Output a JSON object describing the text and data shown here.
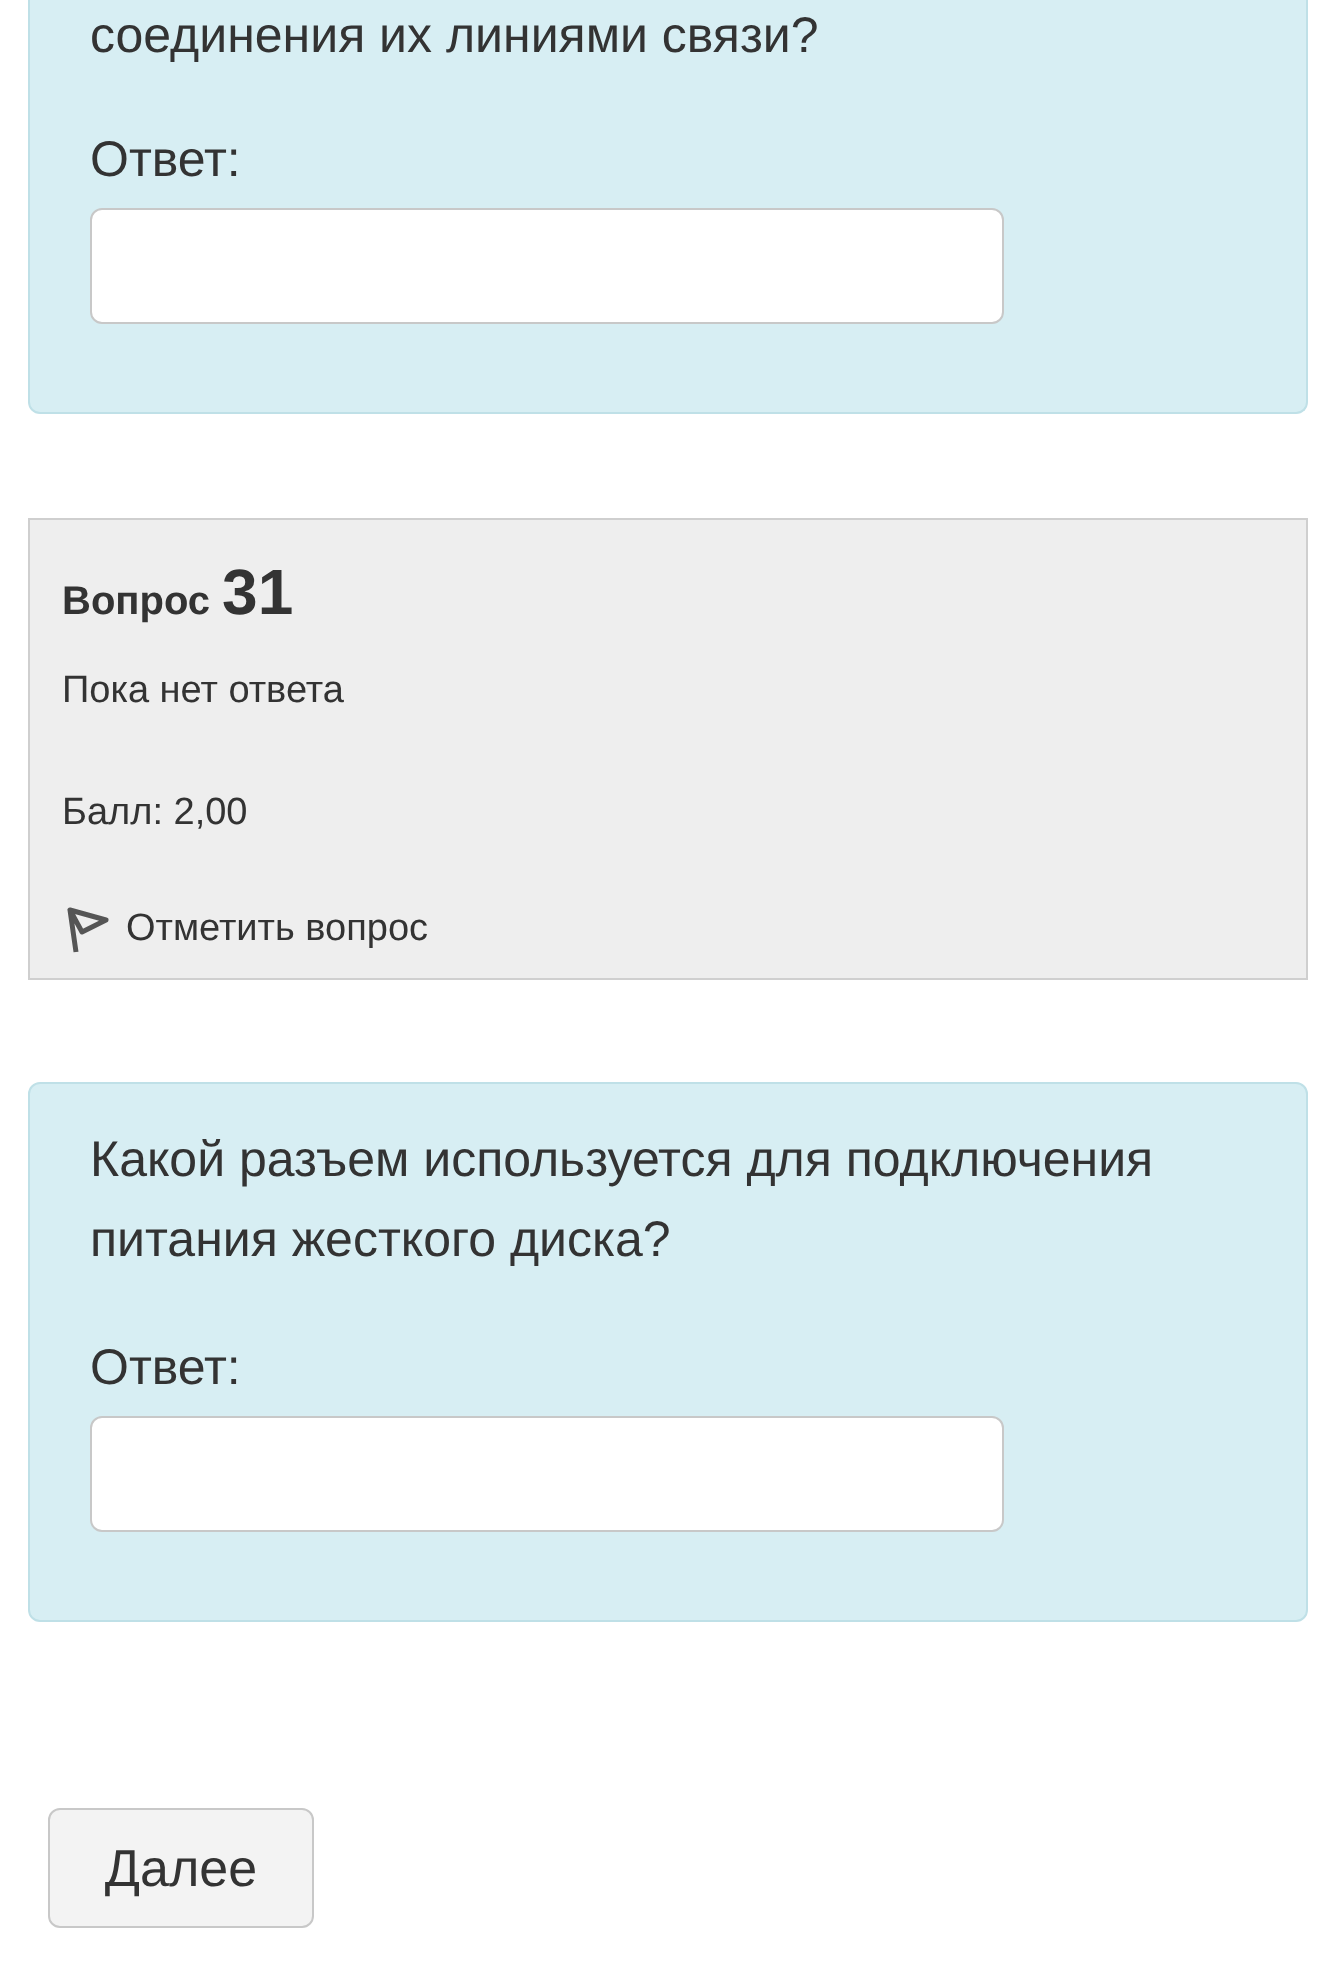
{
  "prev_question": {
    "text": "соединения их линиями связи?",
    "answer_label": "Ответ:"
  },
  "info": {
    "label": "Вопрос",
    "number": "31",
    "status": "Пока нет ответа",
    "grade": "Балл: 2,00",
    "flag": {
      "label": "Отметить вопрос",
      "flagged": false
    }
  },
  "question": {
    "text": "Какой разъем используется для подключения питания жесткого диска?",
    "answer_label": "Ответ:"
  },
  "next_button": "Далее"
}
